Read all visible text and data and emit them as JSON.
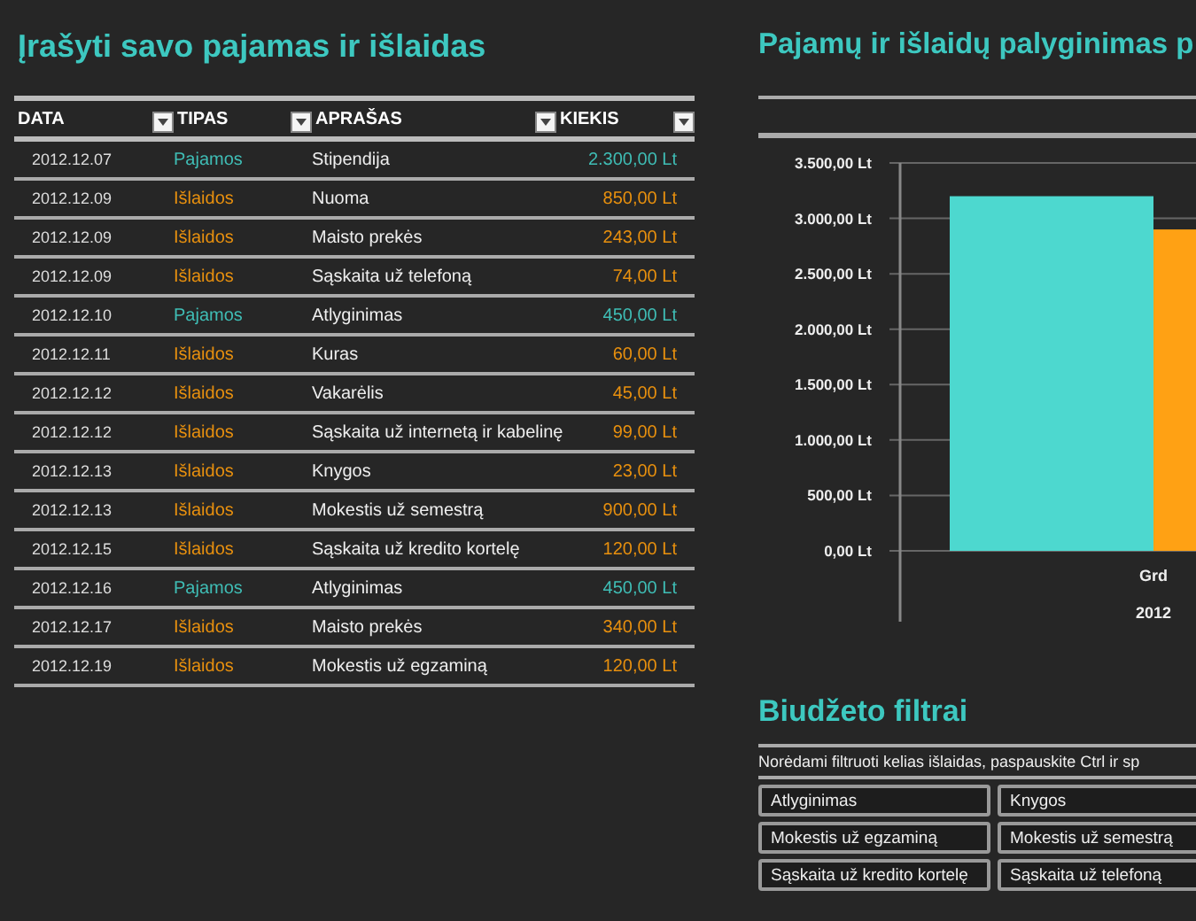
{
  "entries": {
    "title": "Įrašyti savo pajamas ir išlaidas",
    "columns": [
      "DATA",
      "TIPAS",
      "APRAŠAS",
      "KIEKIS"
    ],
    "rows": [
      {
        "date": "2012.12.07",
        "type": "Pajamos",
        "kind": "income",
        "description": "Stipendija",
        "amount": "2.300,00 Lt"
      },
      {
        "date": "2012.12.09",
        "type": "Išlaidos",
        "kind": "expense",
        "description": "Nuoma",
        "amount": "850,00 Lt"
      },
      {
        "date": "2012.12.09",
        "type": "Išlaidos",
        "kind": "expense",
        "description": "Maisto prekės",
        "amount": "243,00 Lt"
      },
      {
        "date": "2012.12.09",
        "type": "Išlaidos",
        "kind": "expense",
        "description": "Sąskaita už telefoną",
        "amount": "74,00 Lt"
      },
      {
        "date": "2012.12.10",
        "type": "Pajamos",
        "kind": "income",
        "description": "Atlyginimas",
        "amount": "450,00 Lt"
      },
      {
        "date": "2012.12.11",
        "type": "Išlaidos",
        "kind": "expense",
        "description": "Kuras",
        "amount": "60,00 Lt"
      },
      {
        "date": "2012.12.12",
        "type": "Išlaidos",
        "kind": "expense",
        "description": "Vakarėlis",
        "amount": "45,00 Lt"
      },
      {
        "date": "2012.12.12",
        "type": "Išlaidos",
        "kind": "expense",
        "description": "Sąskaita už internetą ir kabelinę",
        "amount": "99,00 Lt"
      },
      {
        "date": "2012.12.13",
        "type": "Išlaidos",
        "kind": "expense",
        "description": "Knygos",
        "amount": "23,00 Lt"
      },
      {
        "date": "2012.12.13",
        "type": "Išlaidos",
        "kind": "expense",
        "description": "Mokestis už semestrą",
        "amount": "900,00 Lt"
      },
      {
        "date": "2012.12.15",
        "type": "Išlaidos",
        "kind": "expense",
        "description": "Sąskaita už kredito kortelę",
        "amount": "120,00 Lt"
      },
      {
        "date": "2012.12.16",
        "type": "Pajamos",
        "kind": "income",
        "description": "Atlyginimas",
        "amount": "450,00 Lt"
      },
      {
        "date": "2012.12.17",
        "type": "Išlaidos",
        "kind": "expense",
        "description": "Maisto prekės",
        "amount": "340,00 Lt"
      },
      {
        "date": "2012.12.19",
        "type": "Išlaidos",
        "kind": "expense",
        "description": "Mokestis už egzaminą",
        "amount": "120,00 Lt"
      }
    ]
  },
  "comparison": {
    "title": "Pajamų ir išlaidų palyginimas p",
    "chart_data": {
      "type": "bar",
      "categories": [
        "Grd"
      ],
      "xlabel": "2012",
      "series": [
        {
          "color": "#4dd8cf",
          "values": [
            3200
          ]
        },
        {
          "color": "#ffa114",
          "values": [
            2900
          ]
        }
      ],
      "grid": true,
      "ylim": [
        0,
        3500
      ],
      "yticks": [
        {
          "value": 0,
          "label": "0,00 Lt"
        },
        {
          "value": 500,
          "label": "500,00 Lt"
        },
        {
          "value": 1000,
          "label": "1.000,00 Lt"
        },
        {
          "value": 1500,
          "label": "1.500,00 Lt"
        },
        {
          "value": 2000,
          "label": "2.000,00 Lt"
        },
        {
          "value": 2500,
          "label": "2.500,00 Lt"
        },
        {
          "value": 3000,
          "label": "3.000,00 Lt"
        },
        {
          "value": 3500,
          "label": "3.500,00 Lt"
        }
      ]
    }
  },
  "filters": {
    "title": "Biudžeto filtrai",
    "hint": "Norėdami filtruoti kelias išlaidas, paspauskite Ctrl ir sp",
    "items": [
      "Atlyginimas",
      "Knygos",
      "Mokestis už egzaminą",
      "Mokestis už semestrą",
      "Sąskaita už kredito kortelę",
      "Sąskaita už telefoną"
    ]
  }
}
